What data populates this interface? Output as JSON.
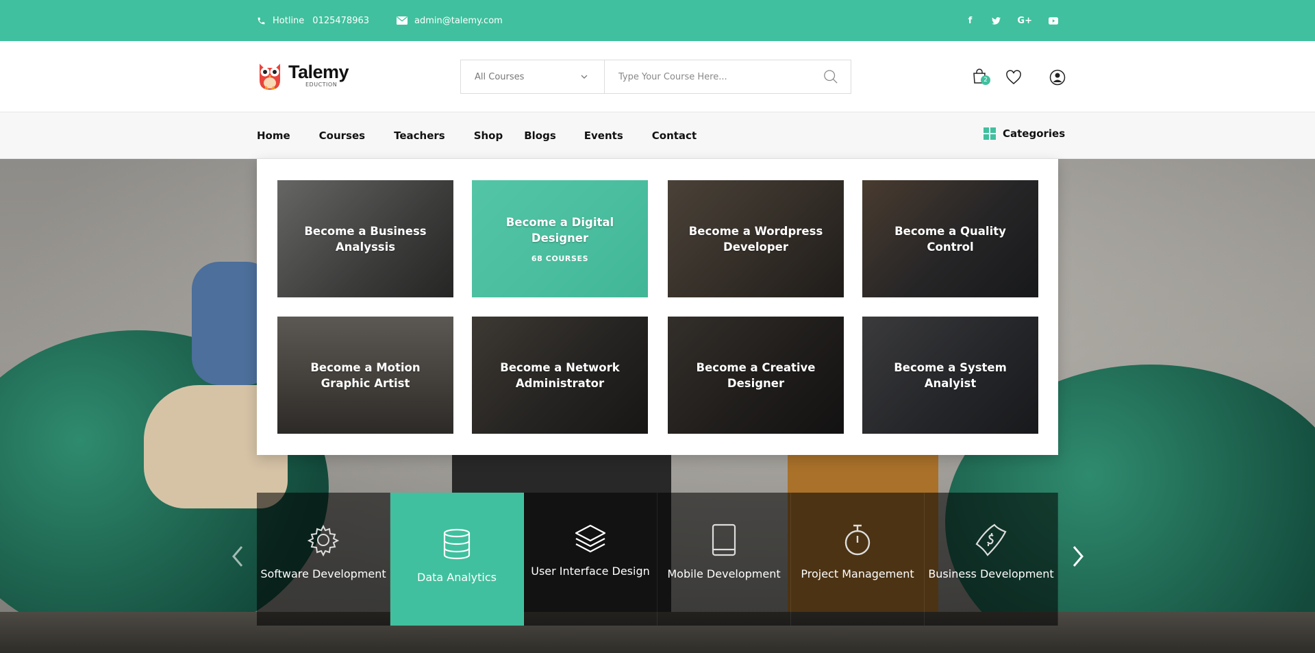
{
  "topbar": {
    "hotline_label": "Hotline",
    "hotline_number": "0125478963",
    "email": "admin@talemy.com",
    "socials": [
      {
        "icon": "facebook-icon",
        "glyph": "f"
      },
      {
        "icon": "twitter-icon",
        "glyph": "t"
      },
      {
        "icon": "google-plus-icon",
        "glyph": "G+"
      },
      {
        "icon": "youtube-icon",
        "glyph": "▶"
      }
    ]
  },
  "brand": {
    "name": "Talemy",
    "tagline": "EDUCTION",
    "accent": "#40c09e"
  },
  "search": {
    "category": "All Courses",
    "placeholder": "Type Your Course Here..."
  },
  "cart": {
    "count": "2"
  },
  "nav": {
    "items": [
      "Home",
      "Courses",
      "Teachers",
      "Shop",
      "Blogs",
      "Events",
      "Contact"
    ],
    "categories_label": "Categories"
  },
  "mega_menu": {
    "tiles": [
      {
        "title": "Become a Business Analyssis",
        "count": ""
      },
      {
        "title": "Become a Digital Designer",
        "count": "68 COURSES"
      },
      {
        "title": "Become a Wordpress Developer",
        "count": ""
      },
      {
        "title": "Become a Quality Control",
        "count": ""
      },
      {
        "title": "Become a Motion Graphic Artist",
        "count": ""
      },
      {
        "title": "Become a Network Administrator",
        "count": ""
      },
      {
        "title": "Become a Creative Designer",
        "count": ""
      },
      {
        "title": "Become a System Analyist",
        "count": ""
      }
    ]
  },
  "category_bar": {
    "items": [
      {
        "label": "Software Development",
        "icon": "gear-icon"
      },
      {
        "label": "Data Analytics",
        "icon": "database-icon"
      },
      {
        "label": "User Interface Design",
        "icon": "layers-icon"
      },
      {
        "label": "Mobile Development",
        "icon": "mobile-icon"
      },
      {
        "label": "Project Management",
        "icon": "stopwatch-icon"
      },
      {
        "label": "Business Development",
        "icon": "money-icon"
      }
    ]
  }
}
